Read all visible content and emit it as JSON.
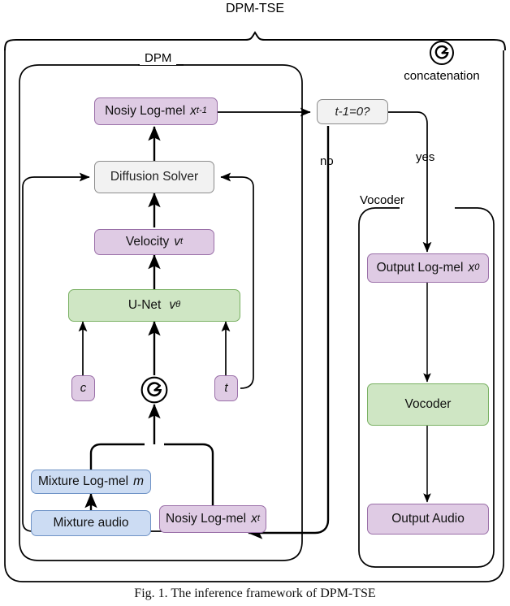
{
  "figure": {
    "title": "DPM-TSE",
    "caption": "Fig. 1. The inference framework of DPM-TSE",
    "legend": {
      "icon": "concatenation-icon",
      "label": "concatenation"
    }
  },
  "groups": {
    "outer": {
      "label": "DPM-TSE"
    },
    "dpm": {
      "label": "DPM"
    },
    "vocoder": {
      "label": "Vocoder"
    }
  },
  "nodes": {
    "noisy_prev": {
      "label": "Nosiy Log-mel",
      "symbol": "x",
      "sub": "t-1",
      "color": "#dfcbe4"
    },
    "decision": {
      "label": "t-1=0?",
      "color": "#f2f2f2"
    },
    "diffusion_solver": {
      "label": "Diffusion Solver",
      "color": "#f2f2f2"
    },
    "velocity": {
      "label": "Velocity",
      "symbol": "v",
      "sub": "t",
      "color": "#dfcbe4"
    },
    "unet": {
      "label": "U-Net",
      "symbol": "v",
      "sub": "θ",
      "color": "#cfe6c4"
    },
    "cond_c": {
      "label": "c",
      "color": "#dfcbe4"
    },
    "step_t": {
      "label": "t",
      "color": "#dfcbe4"
    },
    "concat_mid": {
      "label": "concatenation",
      "icon": "concatenation-icon"
    },
    "mixture_logmel": {
      "label": "Mixture Log-mel",
      "symbol": "m",
      "sub": "",
      "color": "#ccdcf3"
    },
    "mixture_audio": {
      "label": "Mixture audio",
      "color": "#ccdcf3"
    },
    "noisy_t": {
      "label": "Nosiy Log-mel",
      "symbol": "x",
      "sub": "t",
      "color": "#dfcbe4"
    },
    "output_logmel": {
      "label": "Output Log-mel",
      "symbol": "x",
      "sub": "0",
      "color": "#dfcbe4"
    },
    "vocoder_box": {
      "label": "Vocoder",
      "color": "#cfe6c4"
    },
    "output_audio": {
      "label": "Output Audio",
      "color": "#dfcbe4"
    }
  },
  "edge_labels": {
    "no": "no",
    "yes": "yes"
  }
}
